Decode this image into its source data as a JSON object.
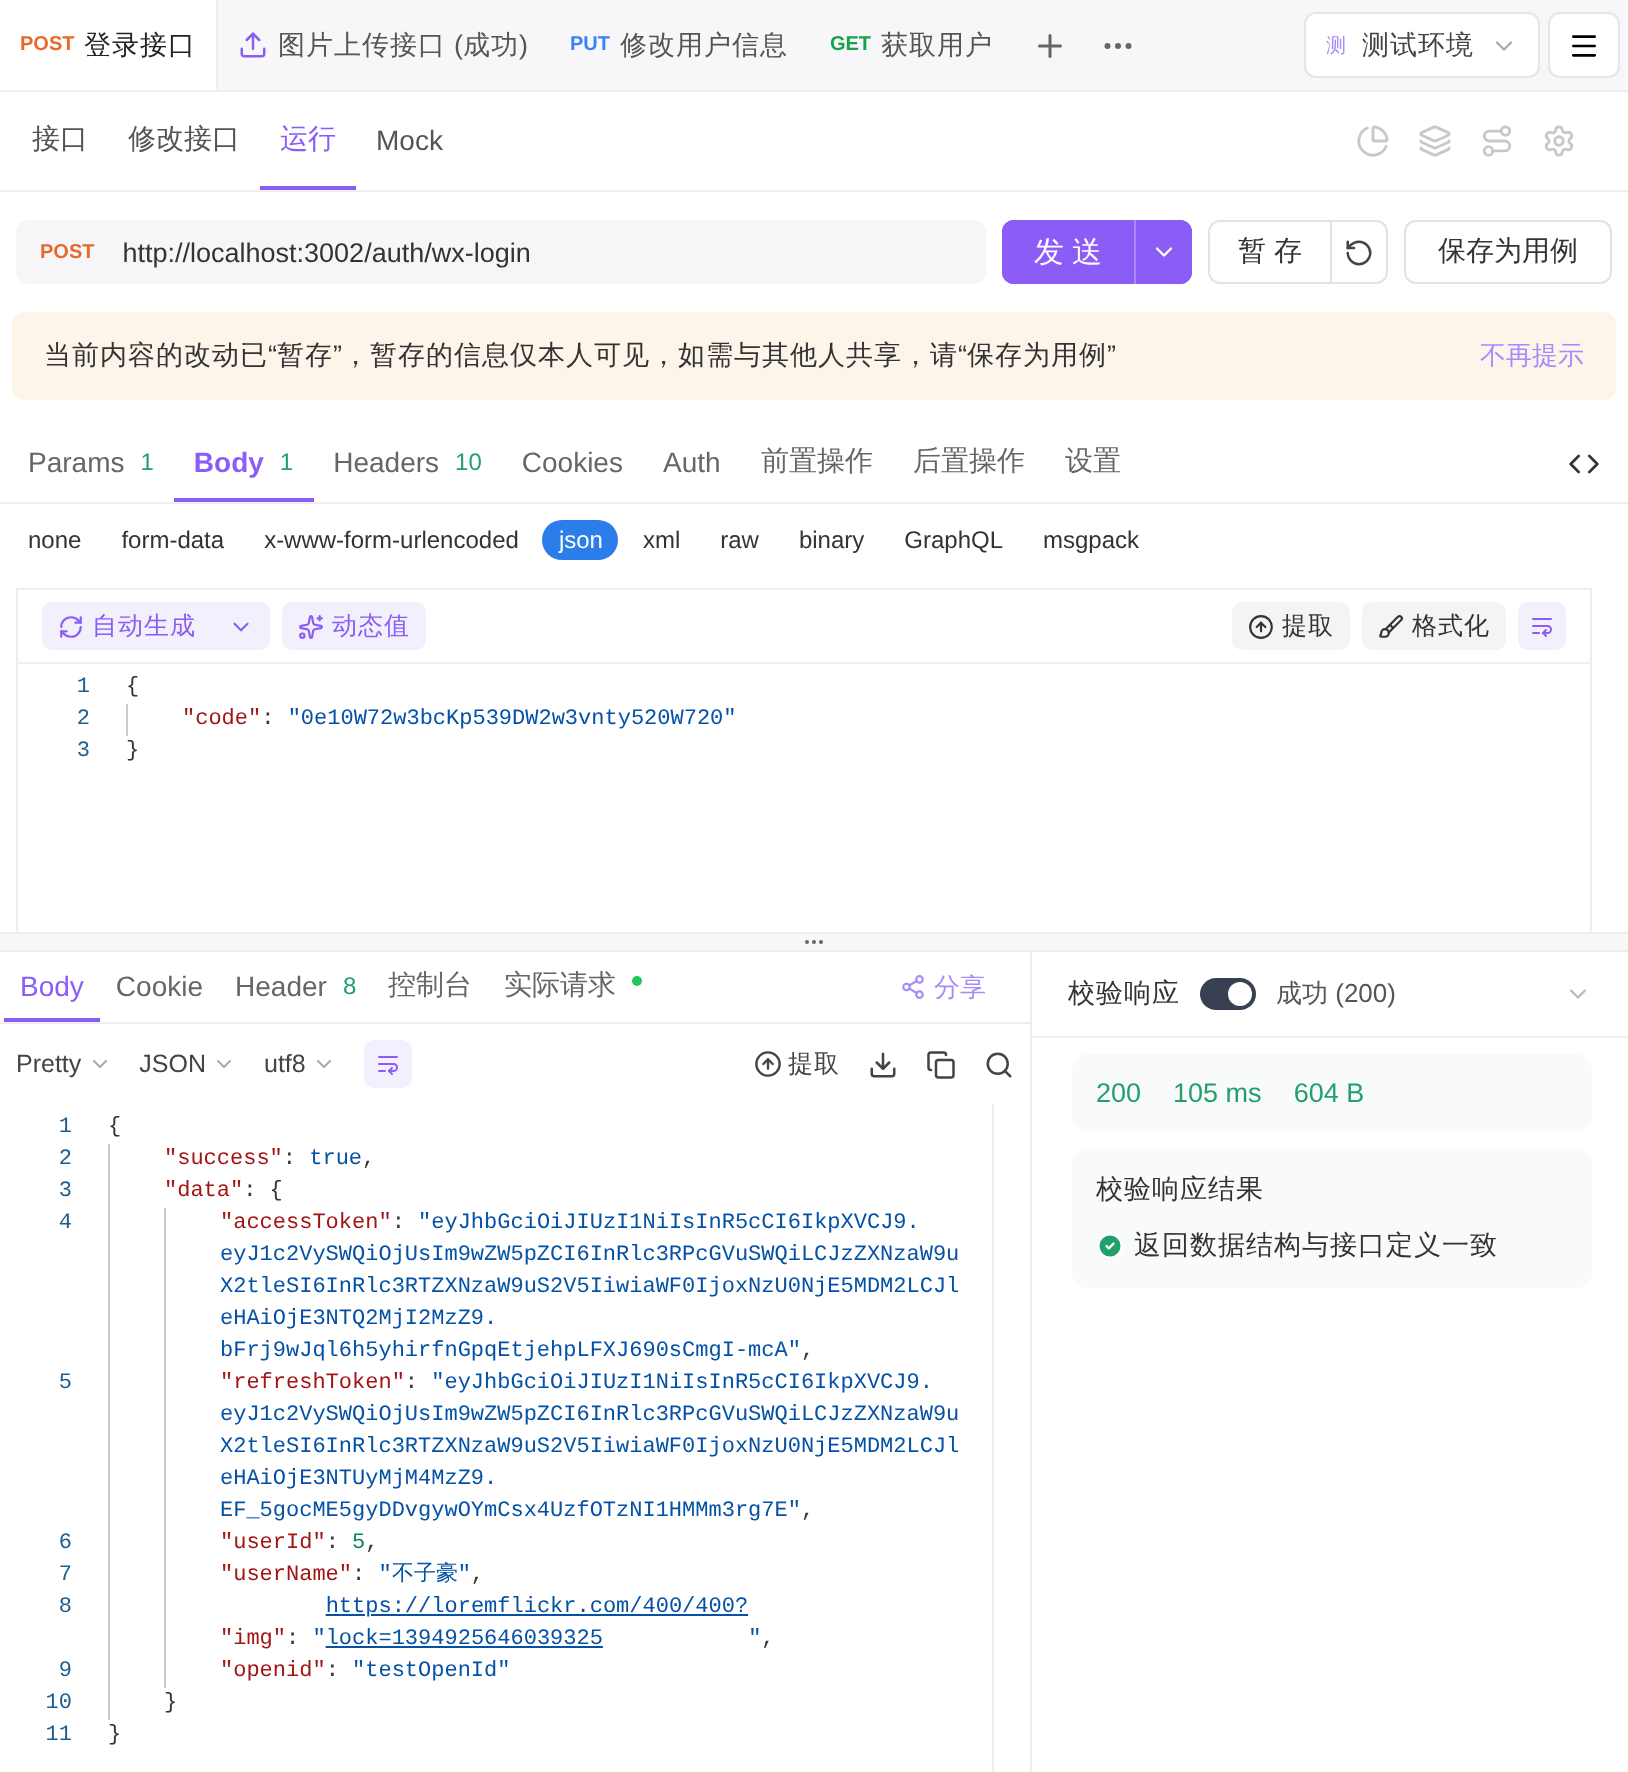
{
  "request_tabs": [
    {
      "kind": "method",
      "method": "POST",
      "color": "#e8692b",
      "label": "登录接口",
      "selected": true
    },
    {
      "kind": "upload",
      "label": "图片上传接口 (成功)",
      "selected": false
    },
    {
      "kind": "method",
      "method": "PUT",
      "color": "#3b82f6",
      "label": "修改用户信息",
      "selected": false
    },
    {
      "kind": "method",
      "method": "GET",
      "color": "#16a34a",
      "label": "获取用户",
      "selected": false
    }
  ],
  "environment": {
    "badge": "测",
    "label": "测试环境"
  },
  "sub_tabs": [
    {
      "label": "接口",
      "selected": false
    },
    {
      "label": "修改接口",
      "selected": false
    },
    {
      "label": "运行",
      "selected": true
    },
    {
      "label": "Mock",
      "selected": false
    }
  ],
  "request": {
    "method": "POST",
    "url": "http://localhost:3002/auth/wx-login",
    "send": "发 送",
    "save_draft": "暂 存",
    "save_case": "保存为用例"
  },
  "notice": {
    "text": "当前内容的改动已“暂存”，暂存的信息仅本人可见，如需与其他人共享，请“保存为用例”",
    "dismiss": "不再提示"
  },
  "param_tabs": [
    {
      "label": "Params",
      "count": "1",
      "selected": false
    },
    {
      "label": "Body",
      "count": "1",
      "selected": true
    },
    {
      "label": "Headers",
      "count": "10",
      "selected": false
    },
    {
      "label": "Cookies",
      "selected": false
    },
    {
      "label": "Auth",
      "selected": false
    },
    {
      "label": "前置操作",
      "selected": false
    },
    {
      "label": "后置操作",
      "selected": false
    },
    {
      "label": "设置",
      "selected": false
    }
  ],
  "body_types": [
    {
      "label": "none",
      "selected": false
    },
    {
      "label": "form-data",
      "selected": false
    },
    {
      "label": "x-www-form-urlencoded",
      "selected": false
    },
    {
      "label": "json",
      "selected": true
    },
    {
      "label": "xml",
      "selected": false
    },
    {
      "label": "raw",
      "selected": false
    },
    {
      "label": "binary",
      "selected": false
    },
    {
      "label": "GraphQL",
      "selected": false
    },
    {
      "label": "msgpack",
      "selected": false
    }
  ],
  "editor_toolbar": {
    "auto_generate": "自动生成",
    "dynamic_value": "动态值",
    "extract": "提取",
    "format": "格式化"
  },
  "request_body": [
    {
      "number": "1",
      "tokens": [
        {
          "kind": "punct",
          "text": "{"
        }
      ],
      "children": [
        {
          "number": "2",
          "tokens": [
            {
              "kind": "key",
              "text": "\"code\""
            },
            {
              "kind": "punct",
              "text": ": "
            },
            {
              "kind": "string",
              "text": "\"0e10W72w3bcKp539DW2w3vnty520W720\""
            }
          ]
        }
      ]
    },
    {
      "number": "3",
      "tokens": [
        {
          "kind": "punct",
          "text": "}"
        }
      ]
    }
  ],
  "response_tabs": [
    {
      "label": "Body",
      "selected": true
    },
    {
      "label": "Cookie",
      "selected": false
    },
    {
      "label": "Header",
      "count": "8",
      "selected": false
    },
    {
      "label": "控制台",
      "selected": false
    },
    {
      "label": "实际请求",
      "indicator": true,
      "selected": false
    }
  ],
  "share": "分享",
  "response_toolbar": {
    "view": "Pretty",
    "format": "JSON",
    "encoding": "utf8",
    "extract": "提取"
  },
  "response_body": [
    {
      "number": "1",
      "tokens": [
        {
          "kind": "punct",
          "text": "{"
        }
      ],
      "children": [
        {
          "number": "2",
          "tokens": [
            {
              "kind": "key",
              "text": "\"success\""
            },
            {
              "kind": "punct",
              "text": ": "
            },
            {
              "kind": "literal",
              "text": "true"
            },
            {
              "kind": "punct",
              "text": ","
            }
          ]
        },
        {
          "number": "3",
          "tokens": [
            {
              "kind": "key",
              "text": "\"data\""
            },
            {
              "kind": "punct",
              "text": ": {"
            }
          ],
          "children": [
            {
              "number": "4",
              "tokens": [
                {
                  "kind": "key",
                  "text": "\"accessToken\""
                },
                {
                  "kind": "punct",
                  "text": ": "
                },
                {
                  "kind": "string",
                  "lines": [
                    "\"eyJhbGciOiJIUzI1NiIsInR5cCI6IkpXVCJ9.",
                    "eyJ1c2VySWQiOjUsIm9wZW5pZCI6InRlc3RPcGVuSWQiLCJzZXNzaW9u",
                    "X2tleSI6InRlc3RTZXNzaW9uS2V5IiwiaWF0IjoxNzU0NjE5MDM2LCJl",
                    "eHAiOjE3NTQ2MjI2MzZ9.",
                    "bFrj9wJql6h5yhirfnGpqEtjehpLFXJ690sCmgI-mcA\""
                  ]
                },
                {
                  "kind": "punct",
                  "text": ","
                }
              ]
            },
            {
              "number": "5",
              "tokens": [
                {
                  "kind": "key",
                  "text": "\"refreshToken\""
                },
                {
                  "kind": "punct",
                  "text": ": "
                },
                {
                  "kind": "string",
                  "lines": [
                    "\"eyJhbGciOiJIUzI1NiIsInR5cCI6IkpXVCJ9.",
                    "eyJ1c2VySWQiOjUsIm9wZW5pZCI6InRlc3RPcGVuSWQiLCJzZXNzaW9u",
                    "X2tleSI6InRlc3RTZXNzaW9uS2V5IiwiaWF0IjoxNzU0NjE5MDM2LCJl",
                    "eHAiOjE3NTUyMjM4MzZ9.",
                    "EF_5gocME5gyDDvgywOYmCsx4UzfOTzNI1HMMm3rg7E\""
                  ]
                },
                {
                  "kind": "punct",
                  "text": ","
                }
              ]
            },
            {
              "number": "6",
              "tokens": [
                {
                  "kind": "key",
                  "text": "\"userId\""
                },
                {
                  "kind": "punct",
                  "text": ": "
                },
                {
                  "kind": "number",
                  "text": "5"
                },
                {
                  "kind": "punct",
                  "text": ","
                }
              ]
            },
            {
              "number": "7",
              "tokens": [
                {
                  "kind": "key",
                  "text": "\"userName\""
                },
                {
                  "kind": "punct",
                  "text": ": "
                },
                {
                  "kind": "string",
                  "text": "\"不子豪\""
                },
                {
                  "kind": "punct",
                  "text": ","
                }
              ]
            },
            {
              "number": "8",
              "tokens": [
                {
                  "kind": "key",
                  "text": "\"img\""
                },
                {
                  "kind": "punct",
                  "text": ": "
                },
                {
                  "kind": "string",
                  "text": "\""
                },
                {
                  "kind": "link",
                  "lines": [
                    "https://loremflickr.com/400/400?",
                    "lock=1394925646039325"
                  ]
                },
                {
                  "kind": "string",
                  "text": "\""
                },
                {
                  "kind": "punct",
                  "text": ","
                }
              ]
            },
            {
              "number": "9",
              "tokens": [
                {
                  "kind": "key",
                  "text": "\"openid\""
                },
                {
                  "kind": "punct",
                  "text": ": "
                },
                {
                  "kind": "string",
                  "text": "\"testOpenId\""
                }
              ]
            }
          ]
        },
        {
          "number": "10",
          "tokens": [
            {
              "kind": "punct",
              "text": "}"
            }
          ]
        }
      ]
    },
    {
      "number": "11",
      "tokens": [
        {
          "kind": "punct",
          "text": "}"
        }
      ]
    }
  ],
  "validation": {
    "label": "校验响应",
    "on": true,
    "status": "成功 (200)"
  },
  "metrics": {
    "status": "200",
    "time": "105 ms",
    "size": "604 B"
  },
  "validation_result": {
    "title": "校验响应结果",
    "message": "返回数据结构与接口定义一致"
  }
}
